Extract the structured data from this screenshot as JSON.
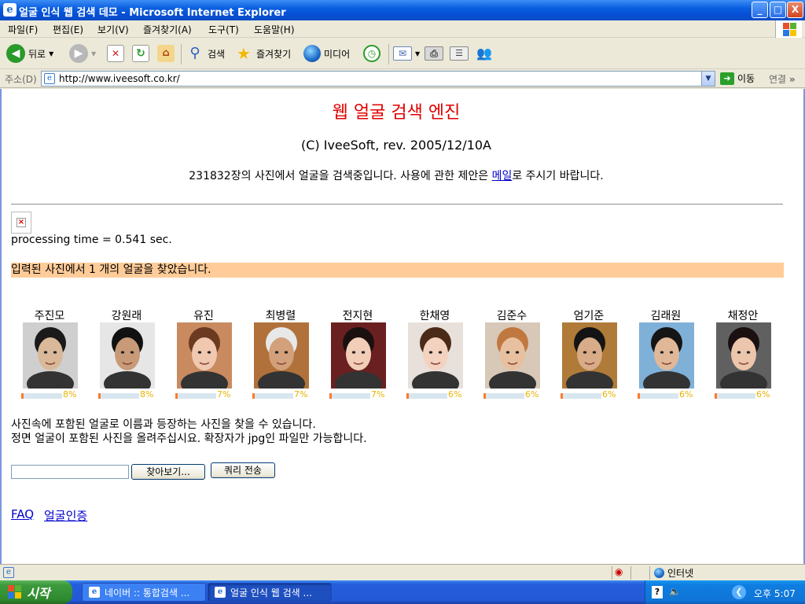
{
  "window": {
    "title": "얼굴 인식 웹 검색 데모 - Microsoft Internet Explorer",
    "min": "_",
    "max": "□",
    "close": "X"
  },
  "menu": [
    "파일(F)",
    "편집(E)",
    "보기(V)",
    "즐겨찾기(A)",
    "도구(T)",
    "도움말(H)"
  ],
  "toolbar": {
    "back": "뒤로",
    "search": "검색",
    "favorites": "즐겨찾기",
    "media": "미디어"
  },
  "address": {
    "label": "주소(D)",
    "url": "http://www.iveesoft.co.kr/",
    "go": "이동",
    "links": "연결",
    "more": "»"
  },
  "page": {
    "title": "웹 얼굴 검색 엔진",
    "subtitle": "(C) IveeSoft, rev. 2005/12/10A",
    "intro_before": "231832장의 사진에서 얼굴을 검색중입니다. 사용에 관한 제안은 ",
    "intro_link": "메일",
    "intro_after": "로 주시기 바랍니다.",
    "processing": "processing time = 0.541 sec.",
    "found": "입력된 사진에서 1 개의 얼굴을 찾았습니다.",
    "desc1": "사진속에 포함된 얼굴로 이름과 등장하는 사진을 찾을 수 있습니다.",
    "desc2": "정면 얼굴이 포함된 사진을 올려주십시요. 확장자가 jpg인 파일만 가능합니다.",
    "browse": "찾아보기...",
    "submit": "쿼리 전송",
    "faq": "FAQ",
    "auth": "얼굴인증"
  },
  "faces": [
    {
      "name": "주진모",
      "pct": "8%",
      "score": 0.08,
      "skin": "#d9b99a",
      "hair": "#1a1a1a",
      "bg": "#cfcfcf"
    },
    {
      "name": "강원래",
      "pct": "8%",
      "score": 0.08,
      "skin": "#c99a78",
      "hair": "#111111",
      "bg": "#e6e6e6"
    },
    {
      "name": "유진",
      "pct": "7%",
      "score": 0.07,
      "skin": "#f0c8b0",
      "hair": "#6b3a20",
      "bg": "#c98a60"
    },
    {
      "name": "최병렬",
      "pct": "7%",
      "score": 0.07,
      "skin": "#d2a07a",
      "hair": "#e8e8e8",
      "bg": "#b0723a"
    },
    {
      "name": "전지현",
      "pct": "7%",
      "score": 0.07,
      "skin": "#f2cdb8",
      "hair": "#1a1010",
      "bg": "#6a2020"
    },
    {
      "name": "한채영",
      "pct": "6%",
      "score": 0.06,
      "skin": "#f3d2bf",
      "hair": "#4a2a18",
      "bg": "#e8e0da"
    },
    {
      "name": "김준수",
      "pct": "6%",
      "score": 0.06,
      "skin": "#e8c0a0",
      "hair": "#c07840",
      "bg": "#d8c8b8"
    },
    {
      "name": "엄기준",
      "pct": "6%",
      "score": 0.06,
      "skin": "#d8ac88",
      "hair": "#141414",
      "bg": "#b07a38"
    },
    {
      "name": "김래원",
      "pct": "6%",
      "score": 0.06,
      "skin": "#e0b898",
      "hair": "#151515",
      "bg": "#7fb0d8"
    },
    {
      "name": "채정안",
      "pct": "6%",
      "score": 0.06,
      "skin": "#ecc6ac",
      "hair": "#1a1010",
      "bg": "#606060"
    }
  ],
  "status": {
    "zone": "인터넷"
  },
  "taskbar": {
    "start": "시작",
    "task1": "네이버 :: 통합검색 ...",
    "task2": "얼굴 인식 웹 검색 ...",
    "help": "?",
    "clock": "오후 5:07"
  }
}
